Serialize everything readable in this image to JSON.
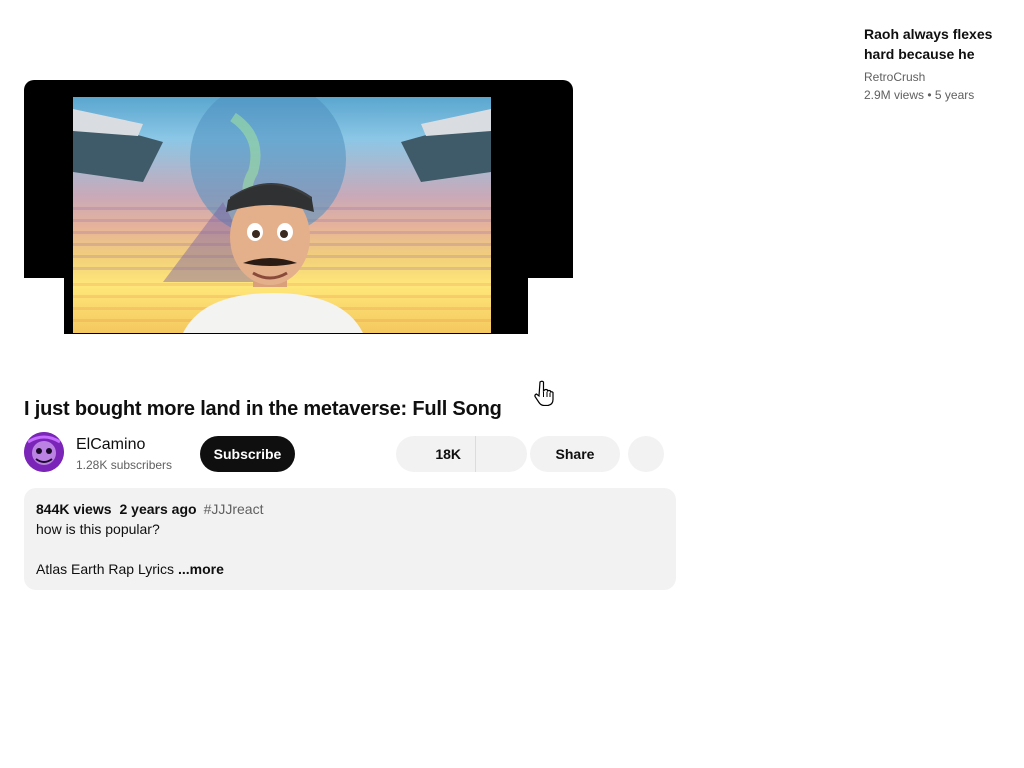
{
  "video": {
    "title": "I just bought more land in the metaverse: Full Song"
  },
  "channel": {
    "name": "ElCamino",
    "subscribers": "1.28K subscribers"
  },
  "actions": {
    "subscribe_label": "Subscribe",
    "like_count": "18K",
    "share_label": "Share"
  },
  "description": {
    "views": "844K views",
    "age": "2 years ago",
    "hashtag": "#JJJreact",
    "line1": "how is this popular?",
    "line2": "Atlas Earth Rap Lyrics",
    "more_label": "...more"
  },
  "related": {
    "title": "Raoh always flexes hard because he",
    "channel": "RetroCrush",
    "views": "2.9M views",
    "age": "5 years"
  },
  "colors": {
    "accent": "#0f0f0f",
    "chip_bg": "#f2f2f2",
    "secondary_text": "#606060"
  }
}
